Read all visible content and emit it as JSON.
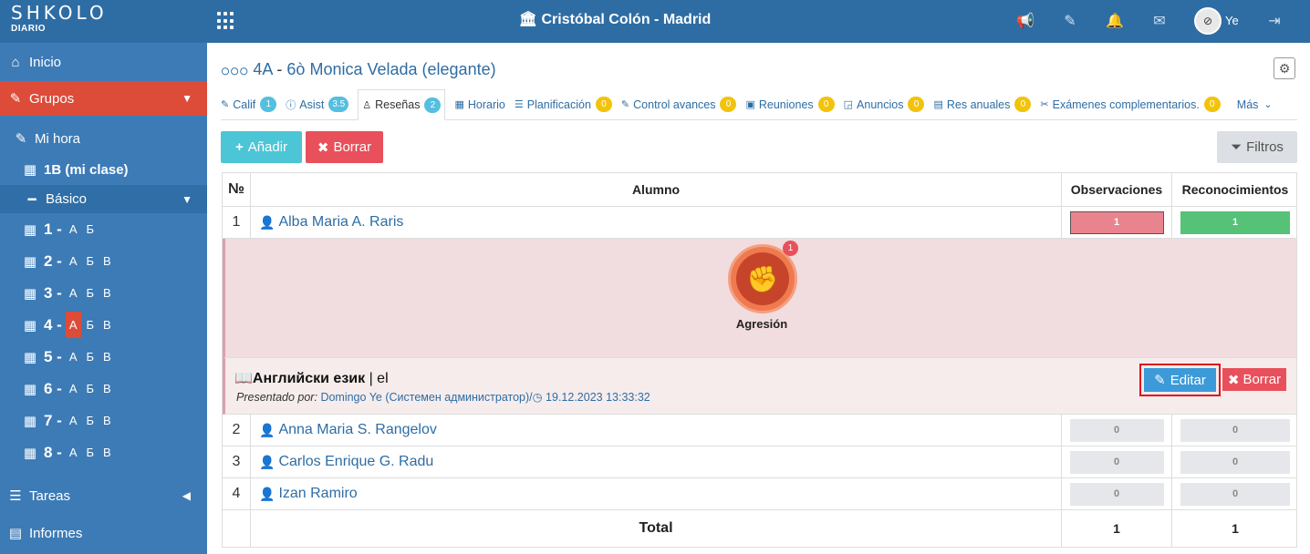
{
  "app": {
    "logo_main": "SHKOLO",
    "logo_sub": "DIARIO",
    "school_name": "Cristóbal Colón - Madrid",
    "user_initials": "Ye"
  },
  "sidebar": {
    "inicio": "Inicio",
    "grupos": "Grupos",
    "mi_hora": "Mi hora",
    "my_class": "1B (mi clase)",
    "basico": "Básico",
    "classes": [
      {
        "num": "1 -",
        "sections": [
          "А",
          "Б"
        ]
      },
      {
        "num": "2 -",
        "sections": [
          "А",
          "Б",
          "В"
        ]
      },
      {
        "num": "3 -",
        "sections": [
          "А",
          "Б",
          "В"
        ]
      },
      {
        "num": "4 -",
        "sections": [
          "А",
          "Б",
          "В"
        ],
        "active": "А"
      },
      {
        "num": "5 -",
        "sections": [
          "А",
          "Б",
          "В"
        ]
      },
      {
        "num": "6 -",
        "sections": [
          "А",
          "Б",
          "В"
        ]
      },
      {
        "num": "7 -",
        "sections": [
          "А",
          "Б",
          "В"
        ]
      },
      {
        "num": "8 -",
        "sections": [
          "А",
          "Б",
          "В"
        ]
      }
    ],
    "tareas": "Tareas",
    "informes": "Informes"
  },
  "page": {
    "class_label": "4A",
    "separator": "-",
    "teacher": "Monica Velada (elegante)"
  },
  "tabs": [
    {
      "label": "Calif",
      "badge": "1",
      "badge_color": "blue",
      "icon": "pencil-icon"
    },
    {
      "label": "Asist",
      "badge": "3.5",
      "badge_color": "blue",
      "icon": "info-icon"
    },
    {
      "label": "Reseñas",
      "badge": "2",
      "badge_color": "blue",
      "icon": "award-icon",
      "active": true
    },
    {
      "label": "Horario",
      "badge": "",
      "icon": "table-icon"
    },
    {
      "label": "Planificación",
      "badge": "0",
      "badge_color": "yellow",
      "icon": "list-icon"
    },
    {
      "label": "Control avances",
      "badge": "0",
      "badge_color": "yellow",
      "icon": "edit-icon"
    },
    {
      "label": "Reuniones",
      "badge": "0",
      "badge_color": "yellow",
      "icon": "calendar-icon"
    },
    {
      "label": "Anuncios",
      "badge": "0",
      "badge_color": "yellow",
      "icon": "note-icon"
    },
    {
      "label": "Res anuales",
      "badge": "0",
      "badge_color": "yellow",
      "icon": "doc-icon"
    },
    {
      "label": "Exámenes complementarios.",
      "badge": "0",
      "badge_color": "yellow",
      "icon": "tools-icon"
    },
    {
      "label": "Más",
      "badge": "",
      "icon": "chevron-down-icon"
    }
  ],
  "toolbar": {
    "add_label": "Añadir",
    "delete_label": "Borrar",
    "filter_label": "Filtros"
  },
  "table": {
    "headers": {
      "num": "№",
      "student": "Alumno",
      "observations": "Observaciones",
      "recognitions": "Reconocimientos"
    },
    "first_row": {
      "num": "1",
      "name": "Alba Maria A. Raris",
      "obs": "1",
      "rec": "1"
    },
    "badge": {
      "count": "1",
      "label": "Agresión"
    },
    "detail": {
      "subject": "Английски език",
      "subject_suffix": "| el",
      "presented_by_label": "Presentado por:",
      "presenter": "Domingo Ye (Системен администратор)/",
      "datetime": "19.12.2023 13:33:32",
      "edit_label": "Editar",
      "delete_label": "Borrar"
    },
    "rows": [
      {
        "num": "2",
        "name": "Anna Maria S. Rangelov",
        "obs": "0",
        "rec": "0"
      },
      {
        "num": "3",
        "name": "Carlos Enrique G. Radu",
        "obs": "0",
        "rec": "0"
      },
      {
        "num": "4",
        "name": "Izan Ramiro",
        "obs": "0",
        "rec": "0"
      }
    ],
    "total": {
      "label": "Total",
      "obs": "1",
      "rec": "1"
    }
  }
}
